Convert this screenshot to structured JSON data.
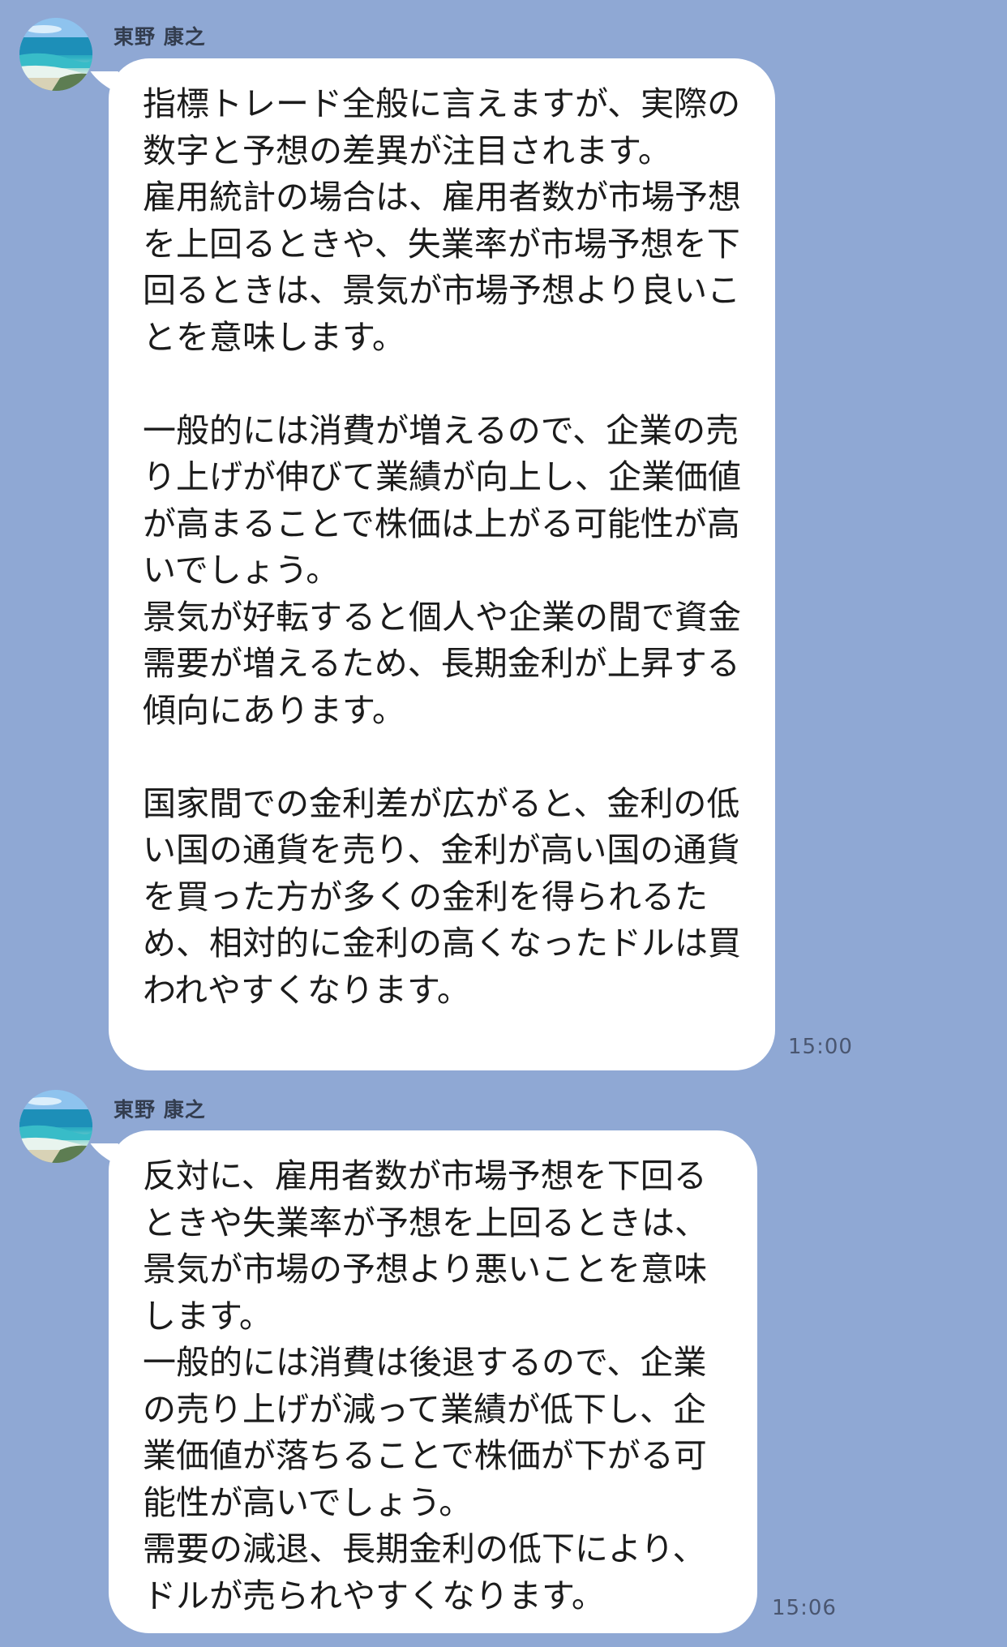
{
  "messages": [
    {
      "sender": "東野 康之",
      "avatar_icon": "beach-photo-avatar",
      "text": "指標トレード全般に言えますが、実際の数字と予想の差異が注目されます。\n雇用統計の場合は、雇用者数が市場予想を上回るときや、失業率が市場予想を下回るときは、景気が市場予想より良いことを意味します。\n\n一般的には消費が増えるので、企業の売り上げが伸びて業績が向上し、企業価値が高まることで株価は上がる可能性が高いでしょう。\n景気が好転すると個人や企業の間で資金需要が増えるため、長期金利が上昇する傾向にあります。\n\n国家間での金利差が広がると、金利の低い国の通貨を売り、金利が高い国の通貨を買った方が多くの金利を得られるため、相対的に金利の高くなったドルは買われやすくなります。",
      "time": "15:00"
    },
    {
      "sender": "東野 康之",
      "avatar_icon": "beach-photo-avatar",
      "text": "反対に、雇用者数が市場予想を下回るときや失業率が予想を上回るときは、景気が市場の予想より悪いことを意味します。\n一般的には消費は後退するので、企業の売り上げが減って業績が低下し、企業価値が落ちることで株価が下がる可能性が高いでしょう。\n需要の減退、長期金利の低下により、ドルが売られやすくなります。",
      "time": "15:06"
    }
  ]
}
